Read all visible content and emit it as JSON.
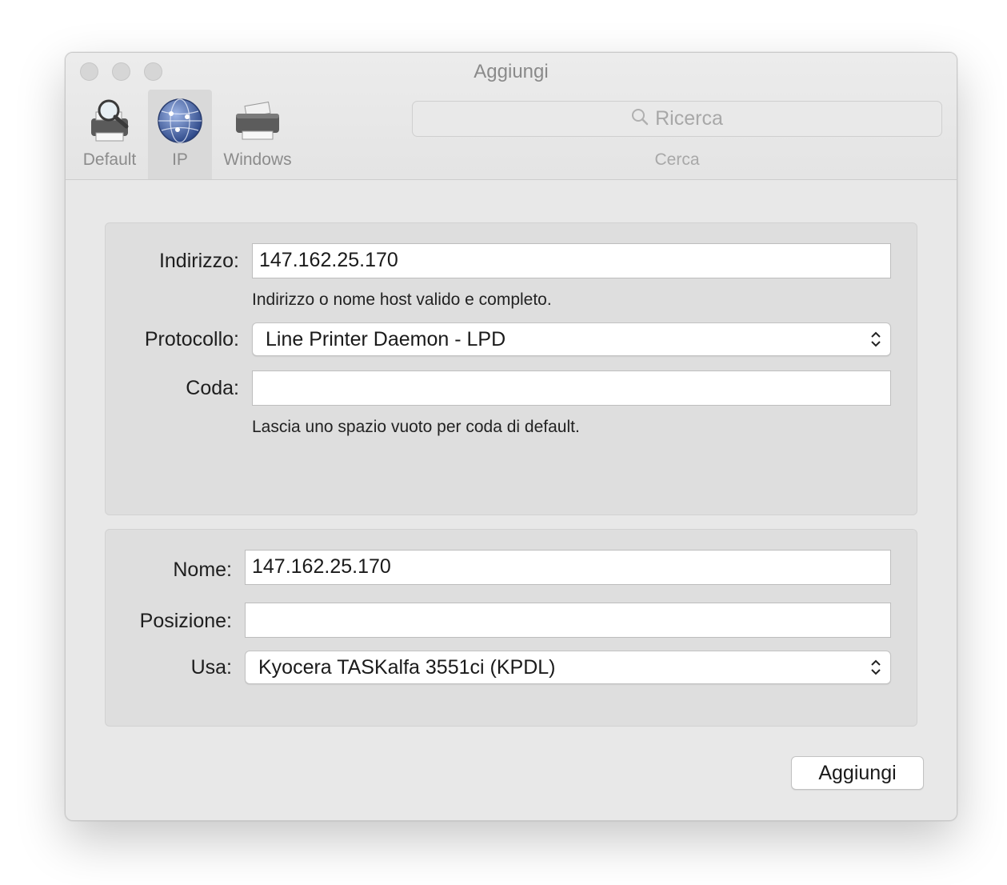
{
  "window": {
    "title": "Aggiungi"
  },
  "toolbar": {
    "items": [
      {
        "label": "Default",
        "icon": "printer-magnifier-icon"
      },
      {
        "label": "IP",
        "icon": "globe-icon",
        "selected": true
      },
      {
        "label": "Windows",
        "icon": "printer-icon"
      }
    ],
    "search": {
      "placeholder": "Ricerca",
      "label": "Cerca"
    }
  },
  "ip_form": {
    "address_label": "Indirizzo:",
    "address_value": "147.162.25.170",
    "address_hint": "Indirizzo o nome host valido e completo.",
    "protocol_label": "Protocollo:",
    "protocol_value": "Line Printer Daemon - LPD",
    "queue_label": "Coda:",
    "queue_value": "",
    "queue_hint": "Lascia uno spazio vuoto per coda di default."
  },
  "printer_form": {
    "name_label": "Nome:",
    "name_value": "147.162.25.170",
    "location_label": "Posizione:",
    "location_value": "",
    "use_label": "Usa:",
    "use_value": "Kyocera TASKalfa 3551ci (KPDL)"
  },
  "actions": {
    "add_label": "Aggiungi"
  },
  "colors": {
    "window_bg": "#e8e8e8",
    "group_bg": "#dedede",
    "disabled_text": "#8c8c8c"
  }
}
